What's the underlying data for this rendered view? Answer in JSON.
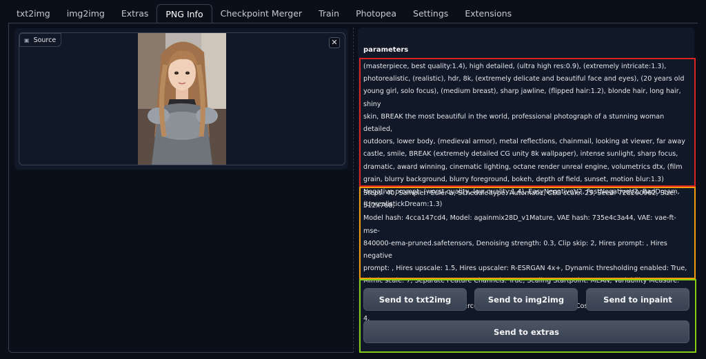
{
  "tabs": [
    {
      "label": "txt2img"
    },
    {
      "label": "img2img"
    },
    {
      "label": "Extras"
    },
    {
      "label": "PNG Info"
    },
    {
      "label": "Checkpoint Merger"
    },
    {
      "label": "Train"
    },
    {
      "label": "Photopea"
    },
    {
      "label": "Settings"
    },
    {
      "label": "Extensions"
    }
  ],
  "active_tab": "PNG Info",
  "source": {
    "label": "Source",
    "close_glyph": "✕"
  },
  "parameters": {
    "title": "parameters",
    "prompt": "(masterpiece, best quality:1.4), high detailed, (ultra high res:0.9), (extremely intricate:1.3),\nphotorealistic, (realistic), hdr, 8k, (extremely delicate and beautiful face and eyes), (20 years old\nyoung girl, solo focus), (medium breast), sharp jawline, (flipped hair:1.2), blonde hair, long hair, shiny\nskin, BREAK the most beautiful in the world, professional photograph of a stunning woman detailed,\noutdoors, lower body, (medieval armor), metal reflections, chainmail, looking at viewer, far away\ncastle, smile, BREAK (extremely detailed CG unity 8k wallpaper), intense sunlight, sharp focus,\ndramatic, award winning, cinematic lighting, octane render unreal engine, volumetrics dtx, (film\ngrain, blurry background, blurry foreground, bokeh, depth of field, sunset, motion blur:1.3)\nNegative prompt: (worst quality, low quality:1.4), EasyNegativeV2, FastNegativeV2, BadDream,\n(UnrealistickDream:1.3)",
    "settings": "Steps: 40, Sampler: Euler a, Schedule type: Automatic, CFG scale: 25, Seed: 728290962, Size: 512x768,\nModel hash: 4cca147cd4, Model: againmix28D_v1Mature, VAE hash: 735e4c3a44, VAE: vae-ft-mse-\n840000-ema-pruned.safetensors, Denoising strength: 0.3, Clip skip: 2, Hires prompt: , Hires negative\nprompt: , Hires upscale: 1.5, Hires upscaler: R-ESRGAN 4x+, Dynamic thresholding enabled: True,\nMimic scale: 7, Separate Feature Channels: True, Scaling Startpoint: MEAN, Variability Measure: AD,\nInterpolate Phi: 1, Threshold percentile: 99.8, Mimic mode: Half Cosine Up, Mimic scale minimum: 4,\nCFG mode: Half Cosine Up, CFG scale minimum: 4, Version: v1.10.1"
  },
  "buttons": {
    "txt2img": "Send to txt2img",
    "img2img": "Send to img2img",
    "inpaint": "Send to inpaint",
    "extras": "Send to extras"
  },
  "colors": {
    "background": "#0b0f19",
    "panel": "#111827",
    "highlight_prompt": "#e02424",
    "highlight_settings": "#f59e0b",
    "highlight_buttons": "#84cc16"
  }
}
